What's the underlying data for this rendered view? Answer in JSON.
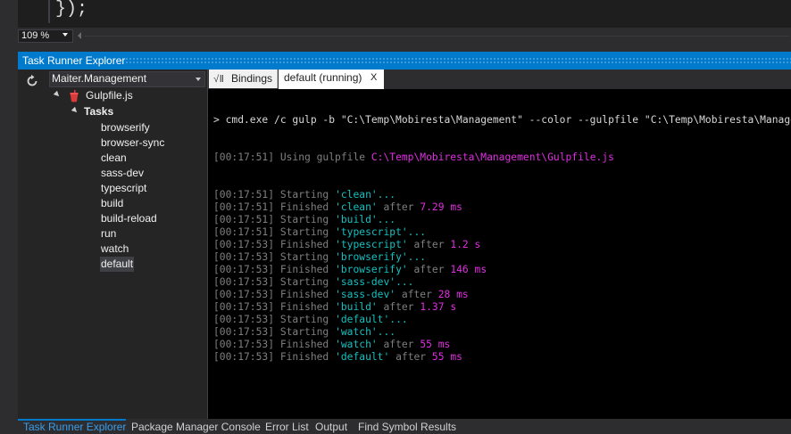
{
  "editor": {
    "code_line": "});"
  },
  "zoom": {
    "value": "109 %"
  },
  "tool_window": {
    "title": "Task Runner Explorer"
  },
  "project_selector": {
    "selected": "Maiter.Management"
  },
  "tree": {
    "gulpfile": "Gulpfile.js",
    "tasks_label": "Tasks",
    "tasks": [
      "browserify",
      "browser-sync",
      "clean",
      "sass-dev",
      "typescript",
      "build",
      "build-reload",
      "run",
      "watch",
      "default"
    ],
    "selected_task": "default"
  },
  "tabs": {
    "bindings_label": "Bindings",
    "bindings_icon": "√Ⅱ",
    "active_label": "default (running)",
    "close_glyph": "X"
  },
  "console": {
    "command": "> cmd.exe /c gulp -b \"C:\\Temp\\Mobiresta\\Management\" --color --gulpfile \"C:\\Temp\\Mobiresta\\Management\\Gulpfile.js\" default",
    "gulpfile_line": {
      "time": "[00:17:51]",
      "text": "Using gulpfile",
      "path": "C:\\Temp\\Mobiresta\\Management\\Gulpfile.js"
    },
    "lines": [
      {
        "time": "[00:17:51]",
        "verb": "Starting",
        "task": "'clean'...",
        "after": "",
        "dur": ""
      },
      {
        "time": "[00:17:51]",
        "verb": "Finished",
        "task": "'clean'",
        "after": "after",
        "dur": "7.29 ms"
      },
      {
        "time": "[00:17:51]",
        "verb": "Starting",
        "task": "'build'...",
        "after": "",
        "dur": ""
      },
      {
        "time": "[00:17:51]",
        "verb": "Starting",
        "task": "'typescript'...",
        "after": "",
        "dur": ""
      },
      {
        "time": "[00:17:53]",
        "verb": "Finished",
        "task": "'typescript'",
        "after": "after",
        "dur": "1.2 s"
      },
      {
        "time": "[00:17:53]",
        "verb": "Starting",
        "task": "'browserify'...",
        "after": "",
        "dur": ""
      },
      {
        "time": "[00:17:53]",
        "verb": "Finished",
        "task": "'browserify'",
        "after": "after",
        "dur": "146 ms"
      },
      {
        "time": "[00:17:53]",
        "verb": "Starting",
        "task": "'sass-dev'...",
        "after": "",
        "dur": ""
      },
      {
        "time": "[00:17:53]",
        "verb": "Finished",
        "task": "'sass-dev'",
        "after": "after",
        "dur": "28 ms"
      },
      {
        "time": "[00:17:53]",
        "verb": "Finished",
        "task": "'build'",
        "after": "after",
        "dur": "1.37 s"
      },
      {
        "time": "[00:17:53]",
        "verb": "Starting",
        "task": "'default'...",
        "after": "",
        "dur": ""
      },
      {
        "time": "[00:17:53]",
        "verb": "Starting",
        "task": "'watch'...",
        "after": "",
        "dur": ""
      },
      {
        "time": "[00:17:53]",
        "verb": "Finished",
        "task": "'watch'",
        "after": "after",
        "dur": "55 ms"
      },
      {
        "time": "[00:17:53]",
        "verb": "Finished",
        "task": "'default'",
        "after": "after",
        "dur": "55 ms"
      }
    ]
  },
  "bottom_tabs": [
    "Task Runner Explorer",
    "Package Manager Console",
    "Error List",
    "Output",
    "Find Symbol Results"
  ],
  "colors": {
    "accent": "#007acc",
    "task_name": "#16c0c0",
    "duration": "#e02ee0",
    "timestamp": "#7f7f7f"
  },
  "icons": {
    "refresh": "refresh-icon",
    "gulp": "gulp-icon",
    "bindings": "bindings-icon"
  }
}
